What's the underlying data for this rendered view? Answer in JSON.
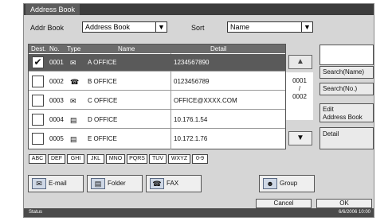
{
  "window": {
    "title": "Address Book"
  },
  "top": {
    "addr_book_label": "Addr Book",
    "addr_book_value": "Address Book",
    "sort_label": "Sort",
    "sort_value": "Name"
  },
  "list": {
    "headers": {
      "dest": "Dest.",
      "no": "No.",
      "type": "Type",
      "name": "Name",
      "detail": "Detail"
    },
    "rows": [
      {
        "checked": "✔",
        "no": "0001",
        "icon": "✉",
        "name": "A OFFICE",
        "detail": "1234567890"
      },
      {
        "checked": "",
        "no": "0002",
        "icon": "☎",
        "name": "B OFFICE",
        "detail": "0123456789"
      },
      {
        "checked": "",
        "no": "0003",
        "icon": "✉",
        "name": "C OFFICE",
        "detail": "OFFICE@XXXX.COM"
      },
      {
        "checked": "",
        "no": "0004",
        "icon": "▤",
        "name": "D OFFICE",
        "detail": "10.176.1.54"
      },
      {
        "checked": "",
        "no": "0005",
        "icon": "▤",
        "name": "E OFFICE",
        "detail": "10.172.1.76"
      }
    ]
  },
  "pager": {
    "current": "0001",
    "sep": "/",
    "total": "0002"
  },
  "side": {
    "search_name": "Search(Name)",
    "search_no": "Search(No.)",
    "edit_line1": "Edit",
    "edit_line2": "Address Book",
    "detail": "Detail"
  },
  "alpha_tabs": [
    "ABC",
    "DEF",
    "GHI",
    "JKL",
    "MNO",
    "PQRS",
    "TUV",
    "WXYZ",
    "0-9"
  ],
  "dest_buttons": {
    "email": "E-mail",
    "folder": "Folder",
    "fax": "FAX",
    "group": "Group"
  },
  "footer": {
    "cancel": "Cancel",
    "ok": "OK",
    "status": "Status",
    "datetime": "6/6/2006 10:00"
  }
}
